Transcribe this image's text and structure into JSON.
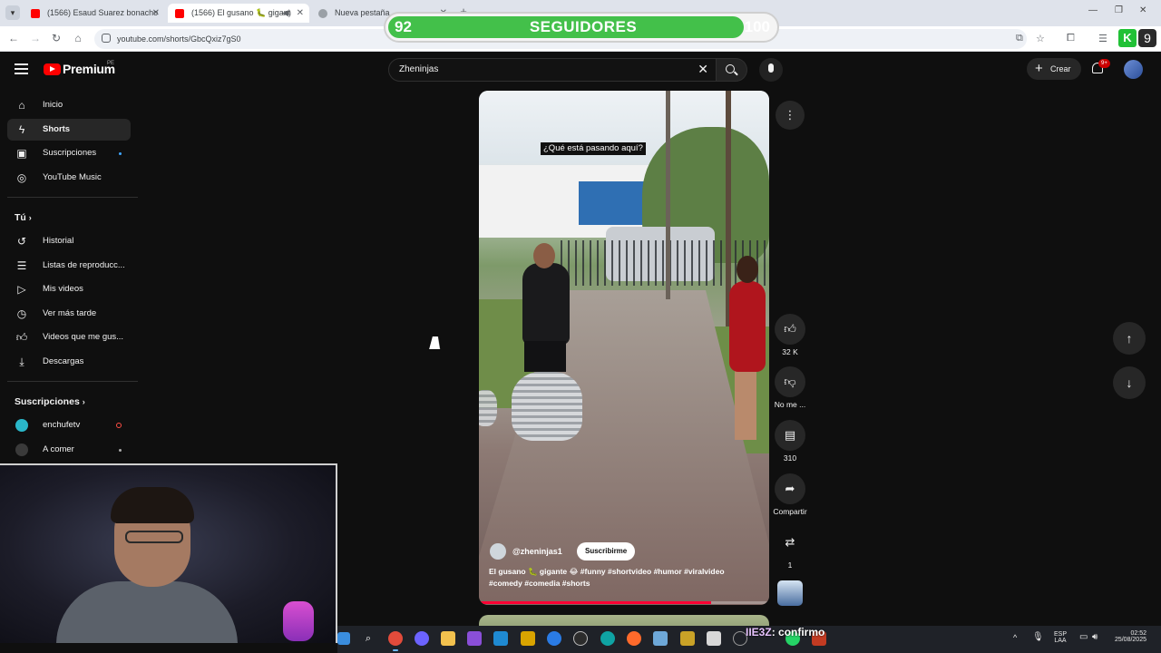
{
  "browser": {
    "tabs": [
      {
        "title": "(1566) Esaud Suarez bonacho",
        "active": false
      },
      {
        "title": "(1566) El gusano 🐛 gigant",
        "active": true
      },
      {
        "title": "Nueva pestaña",
        "active": false
      }
    ],
    "url": "youtube.com/shorts/GbcQxiz7gS0"
  },
  "overlay": {
    "followers_current": "92",
    "followers_label": "SEGUIDORES",
    "followers_goal": "100",
    "accent_green": "#43c04a"
  },
  "masthead": {
    "logo_text": "Premium",
    "region": "PE",
    "search_value": "Zheninjas",
    "create_label": "Crear",
    "notifications_badge": "9+"
  },
  "sidebar": {
    "main": [
      {
        "label": "Inicio",
        "icon": "home-icon",
        "active": false
      },
      {
        "label": "Shorts",
        "icon": "shorts-icon",
        "active": true
      },
      {
        "label": "Suscripciones",
        "icon": "subscriptions-icon",
        "active": false
      },
      {
        "label": "YouTube Music",
        "icon": "music-icon",
        "active": false
      }
    ],
    "you_header": "Tú",
    "you": [
      {
        "label": "Historial",
        "icon": "history-icon"
      },
      {
        "label": "Listas de reproducc...",
        "icon": "playlist-icon"
      },
      {
        "label": "Mis videos",
        "icon": "my-videos-icon"
      },
      {
        "label": "Ver más tarde",
        "icon": "clock-icon"
      },
      {
        "label": "Videos que me gus...",
        "icon": "thumbs-up-icon"
      },
      {
        "label": "Descargas",
        "icon": "download-icon"
      }
    ],
    "subs_header": "Suscripciones",
    "subs": [
      {
        "label": "enchufetv"
      },
      {
        "label": "A comer"
      }
    ]
  },
  "short": {
    "caption": "¿Qué está pasando aquí?",
    "channel": "@zheninjas1",
    "subscribe_label": "Suscribirme",
    "description": "El gusano 🐛 gigante 😂 #funny #shortvideo #humor #viralvideo #comedy #comedia #shorts",
    "progress": 0.8
  },
  "actions": {
    "likes": "32 K",
    "dislike_label": "No me ...",
    "comments": "310",
    "share_label": "Compartir",
    "remix_count": "1"
  },
  "taskbar": {
    "chat_user": "IIE3Z",
    "chat_message": ": confirmo",
    "lang": "ESP",
    "lang_region": "LAA",
    "time": "02:52",
    "date": "25/08/2025"
  }
}
